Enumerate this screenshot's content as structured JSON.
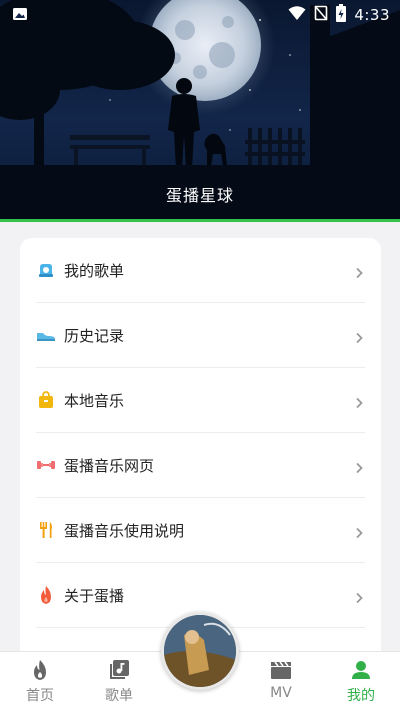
{
  "status_bar": {
    "time": "4:33",
    "icons": [
      "image-icon",
      "wifi-icon",
      "no-sim-icon",
      "battery-icon"
    ]
  },
  "header": {
    "title": "蛋播星球"
  },
  "menu": {
    "items": [
      {
        "label": "我的歌单",
        "icon": "cloud-folder-icon",
        "color": "#4ab3e8"
      },
      {
        "label": "历史记录",
        "icon": "shoe-icon",
        "color": "#5ab8e6"
      },
      {
        "label": "本地音乐",
        "icon": "bag-icon",
        "color": "#f2b70d"
      },
      {
        "label": "蛋播音乐网页",
        "icon": "dumbbell-icon",
        "color": "#f26d6d"
      },
      {
        "label": "蛋播音乐使用说明",
        "icon": "fork-icon",
        "color": "#f2a00d"
      },
      {
        "label": "关于蛋播",
        "icon": "fire-icon",
        "color": "#f25c3a"
      }
    ]
  },
  "bottom_nav": {
    "items": [
      {
        "label": "首页",
        "icon": "flame-icon",
        "active": false
      },
      {
        "label": "歌单",
        "icon": "playlist-icon",
        "active": false
      },
      {
        "label": "MV",
        "icon": "clapperboard-icon",
        "active": false
      },
      {
        "label": "我的",
        "icon": "person-icon",
        "active": true
      }
    ],
    "accent_color": "#31b04a"
  }
}
